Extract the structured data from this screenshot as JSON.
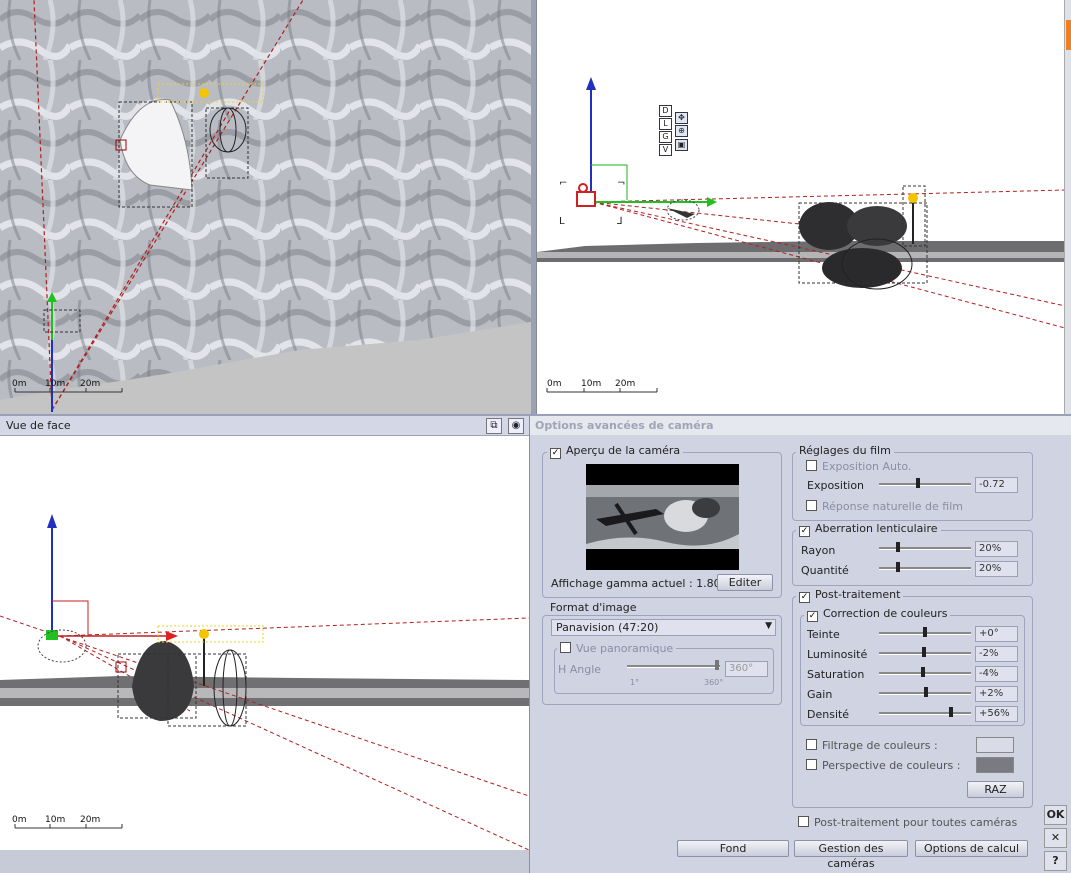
{
  "viewports": {
    "top": {
      "scale_labels": [
        "0m",
        "10m",
        "20m"
      ]
    },
    "right": {
      "scale_labels": [
        "0m",
        "10m",
        "20m"
      ],
      "nav_letters": [
        "D",
        "L",
        "G",
        "V"
      ]
    },
    "front": {
      "title": "Vue de face",
      "scale_labels": [
        "0m",
        "10m",
        "20m"
      ]
    }
  },
  "panel": {
    "title": "Options avancées de caméra",
    "preview": {
      "label": "Aperçu de la caméra",
      "checked": true,
      "gamma_label": "Affichage gamma actuel : 1.80",
      "edit_button": "Editer"
    },
    "format": {
      "label": "Format d'image",
      "selected": "Panavision (47:20)",
      "panoramic_label": "Vue panoramique",
      "angle_label": "H Angle",
      "angle_min": "1°",
      "angle_max": "360°",
      "angle_value": "360°"
    },
    "film": {
      "label": "Réglages du film",
      "auto_exposure": "Exposition Auto.",
      "exposure_label": "Exposition",
      "exposure_value": "-0.72",
      "natural_response": "Réponse naturelle de film"
    },
    "lens": {
      "label": "Aberration lenticulaire",
      "checked": true,
      "radius_label": "Rayon",
      "radius_value": "20%",
      "amount_label": "Quantité",
      "amount_value": "20%"
    },
    "post": {
      "label": "Post-traitement",
      "checked": true,
      "color_correction": {
        "label": "Correction de couleurs",
        "checked": true,
        "rows": [
          {
            "label": "Teinte",
            "value": "+0°",
            "level": 0.5
          },
          {
            "label": "Luminosité",
            "value": "-2%",
            "level": 0.49
          },
          {
            "label": "Saturation",
            "value": "-4%",
            "level": 0.48
          },
          {
            "label": "Gain",
            "value": "+2%",
            "level": 0.51
          },
          {
            "label": "Densité",
            "value": "+56%",
            "level": 0.78
          }
        ]
      },
      "color_filter": "Filtrage de couleurs :",
      "color_perspective": "Perspective de couleurs :",
      "reset_button": "RAZ",
      "all_cameras": "Post-traitement pour toutes caméras"
    },
    "footer": {
      "background_button": "Fond",
      "cameras_button": "Gestion des caméras",
      "render_button": "Options de calcul"
    },
    "colors": {
      "filter_swatch": "#d9dbe6",
      "perspective_swatch": "#7a7a82"
    }
  },
  "side_buttons": {
    "ok": "OK",
    "close": "✕",
    "help": "?"
  }
}
